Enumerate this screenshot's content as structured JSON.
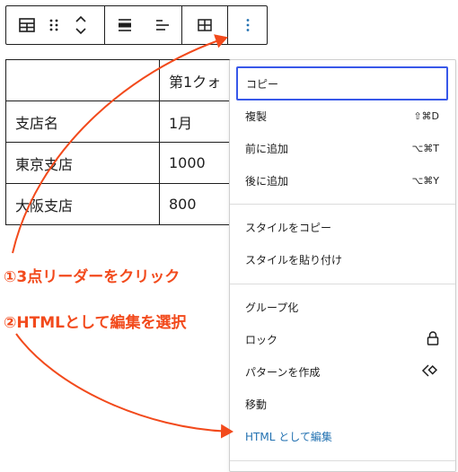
{
  "toolbar": {
    "icons": [
      "table-icon",
      "drag-handle-icon",
      "move-up-down-icon",
      "align-icon",
      "justify-icon",
      "table-edit-icon",
      "more-options-icon"
    ]
  },
  "table": {
    "rows": [
      [
        "",
        "第1クォ"
      ],
      [
        "支店名",
        "1月"
      ],
      [
        "東京支店",
        "1000"
      ],
      [
        "大阪支店",
        "800"
      ]
    ]
  },
  "menu": {
    "copy": "コピー",
    "duplicate": "複製",
    "duplicate_shortcut": "⇧⌘D",
    "insert_before": "前に追加",
    "insert_before_shortcut": "⌥⌘T",
    "insert_after": "後に追加",
    "insert_after_shortcut": "⌥⌘Y",
    "copy_styles": "スタイルをコピー",
    "paste_styles": "スタイルを貼り付け",
    "group": "グループ化",
    "lock": "ロック",
    "create_pattern": "パターンを作成",
    "move": "移動",
    "edit_as_html": "HTML として編集"
  },
  "annotations": {
    "step1": "①3点リーダーをクリック",
    "step2": "②HTMLとして編集を選択",
    "color": "#f24a1c"
  }
}
